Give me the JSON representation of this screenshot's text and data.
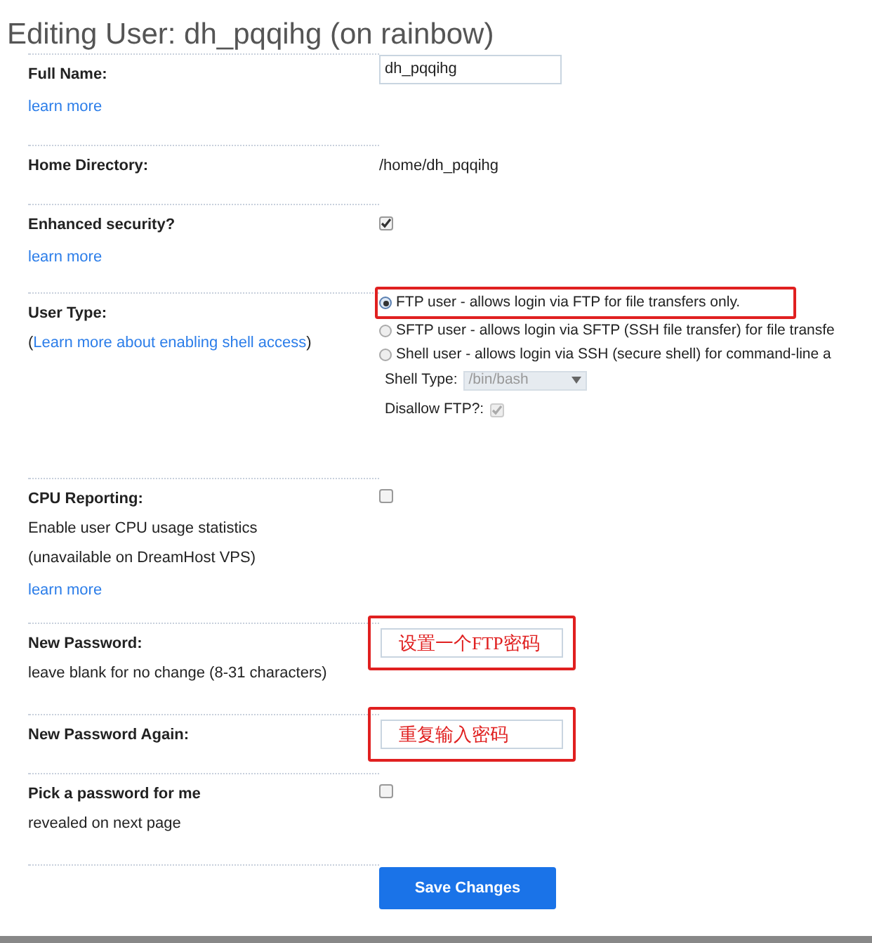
{
  "title": "Editing User: dh_pqqihg (on rainbow)",
  "rows": [
    {
      "kind": "text_input",
      "label": "Full Name:",
      "value": "dh_pqqihg",
      "link": "learn more"
    },
    {
      "kind": "static",
      "label": "Home Directory:",
      "value": "/home/dh_pqqihg"
    },
    {
      "kind": "checkbox",
      "label": "Enhanced security?",
      "checked": true,
      "link": "learn more"
    },
    {
      "kind": "radio_group",
      "label": "User Type:",
      "label_open": "(",
      "label_link": "Learn more about enabling shell access",
      "label_close": ")",
      "options": [
        {
          "text": "FTP user - allows login via FTP for file transfers only.",
          "selected": true,
          "highlighted": true
        },
        {
          "text": "SFTP user - allows login via SFTP (SSH file transfer) for file transfe",
          "selected": false,
          "highlighted": false
        },
        {
          "text": "Shell user - allows login via SSH (secure shell) for command-line a",
          "selected": false,
          "highlighted": false
        }
      ],
      "shell_type_label": "Shell Type:",
      "shell_type": "/bin/bash",
      "disallow_ftp_label": "Disallow FTP?:",
      "disallow_ftp": true
    },
    {
      "kind": "checkbox",
      "label": "CPU Reporting:",
      "notes": [
        "Enable user CPU usage statistics",
        "(unavailable on DreamHost VPS)"
      ],
      "checked": false,
      "link": "learn more"
    },
    {
      "kind": "password",
      "label": "New Password:",
      "notes": [
        "leave blank for no change (8-31 characters)"
      ],
      "value": "设置一个FTP密码",
      "highlighted": true
    },
    {
      "kind": "password",
      "label": "New Password Again:",
      "value": "重复输入密码",
      "highlighted": true
    },
    {
      "kind": "checkbox",
      "label": "Pick a password for me",
      "notes": [
        "revealed on next page"
      ],
      "checked": false
    },
    {
      "kind": "button",
      "label": "Save Changes"
    }
  ]
}
